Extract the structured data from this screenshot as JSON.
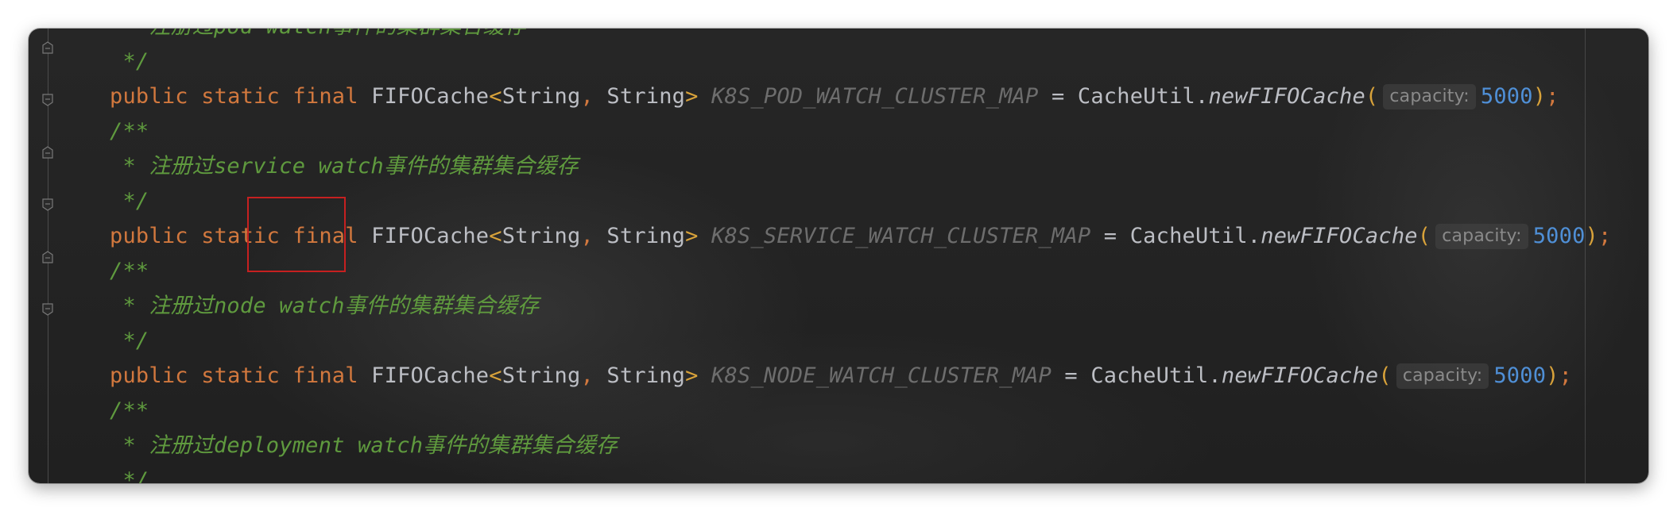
{
  "editor": {
    "lines": [
      {
        "id": "c0",
        "doc": " * 注册过pod watch事件的集群集合缓存"
      },
      {
        "id": "c1",
        "doc": " */"
      },
      {
        "id": "d1",
        "kw1": "public",
        "kw2": "static",
        "kw3": "final",
        "type": "FIFOCache",
        "lt": "<",
        "t1": "String",
        "comma": ",",
        "t2": "String",
        "gt": ">",
        "name": "K8S_POD_WATCH_CLUSTER_MAP",
        "eq": "=",
        "cls": "CacheUtil.",
        "method": "newFIFOCache",
        "lp": "(",
        "hint": "capacity:",
        "num": "5000",
        "rp": ")",
        "semi": ";"
      },
      {
        "id": "c2",
        "doc": "/**"
      },
      {
        "id": "c3",
        "doc": " * 注册过service watch事件的集群集合缓存"
      },
      {
        "id": "c4",
        "doc": " */"
      },
      {
        "id": "d2",
        "kw1": "public",
        "kw2": "static",
        "kw3": "final",
        "type": "FIFOCache",
        "lt": "<",
        "t1": "String",
        "comma": ",",
        "t2": "String",
        "gt": ">",
        "name": "K8S_SERVICE_WATCH_CLUSTER_MAP",
        "eq": "=",
        "cls": "CacheUtil.",
        "method": "newFIFOCache",
        "lp": "(",
        "hint": "capacity:",
        "num": "5000",
        "rp": ")",
        "semi": ";"
      },
      {
        "id": "c5",
        "doc": "/**"
      },
      {
        "id": "c6",
        "doc": " * 注册过node watch事件的集群集合缓存"
      },
      {
        "id": "c7",
        "doc": " */"
      },
      {
        "id": "d3",
        "kw1": "public",
        "kw2": "static",
        "kw3": "final",
        "type": "FIFOCache",
        "lt": "<",
        "t1": "String",
        "comma": ",",
        "t2": "String",
        "gt": ">",
        "name": "K8S_NODE_WATCH_CLUSTER_MAP",
        "eq": "=",
        "cls": "CacheUtil.",
        "method": "newFIFOCache",
        "lp": "(",
        "hint": "capacity:",
        "num": "5000",
        "rp": ")",
        "semi": ";"
      },
      {
        "id": "c8",
        "doc": "/**"
      },
      {
        "id": "c9",
        "doc": " * 注册过deployment watch事件的集群集合缓存"
      },
      {
        "id": "c10",
        "doc": " */"
      }
    ]
  },
  "colors": {
    "keyword": "#d2783e",
    "doc_comment": "#5f9a3e",
    "number": "#4f8fd6",
    "constant": "#6d6d6d",
    "bracket": "#d8a23a",
    "highlight_box": "#c62020"
  },
  "gutter": {
    "fold_icons": [
      "fold-end-icon",
      "fold-start-icon",
      "fold-end-icon",
      "fold-start-icon",
      "fold-end-icon",
      "fold-start-icon"
    ]
  }
}
